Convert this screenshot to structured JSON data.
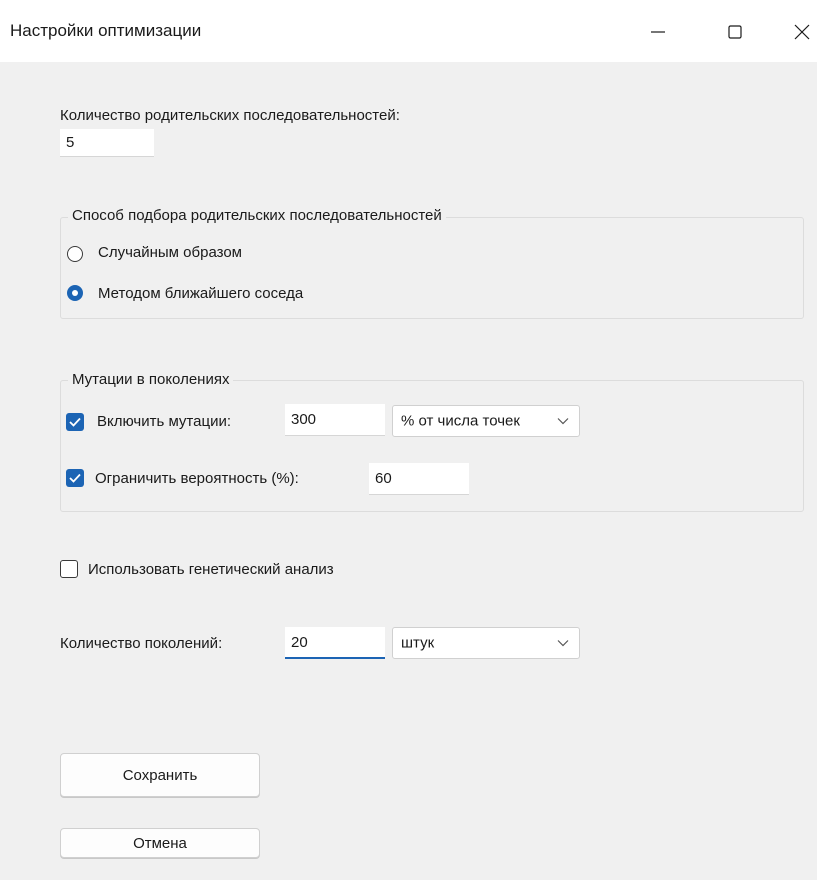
{
  "window": {
    "title": "Настройки оптимизации",
    "controls": {
      "minimize_icon": "minimize-icon",
      "maximize_icon": "maximize-icon",
      "close_icon": "close-icon"
    }
  },
  "parent_count": {
    "label": "Количество родительских последовательностей:",
    "value": "5"
  },
  "selection_method": {
    "legend": "Способ подбора родительских последовательностей",
    "options": [
      {
        "label": "Случайным образом",
        "checked": false
      },
      {
        "label": "Методом ближайшего соседа",
        "checked": true
      }
    ]
  },
  "mutations": {
    "legend": "Мутации в поколениях",
    "enable": {
      "label": "Включить мутации:",
      "checked": true,
      "value": "300",
      "unit": "% от числа точек"
    },
    "limit": {
      "label": "Ограничить вероятность (%):",
      "checked": true,
      "value": "60"
    }
  },
  "genetic_analysis": {
    "label": "Использовать генетический анализ",
    "checked": false
  },
  "generations": {
    "label": "Количество поколений:",
    "value": "20",
    "unit": "штук"
  },
  "buttons": {
    "save": "Сохранить",
    "cancel": "Отмена"
  },
  "colors": {
    "accent": "#1c64b4",
    "window_bg": "#f0f0f0"
  }
}
